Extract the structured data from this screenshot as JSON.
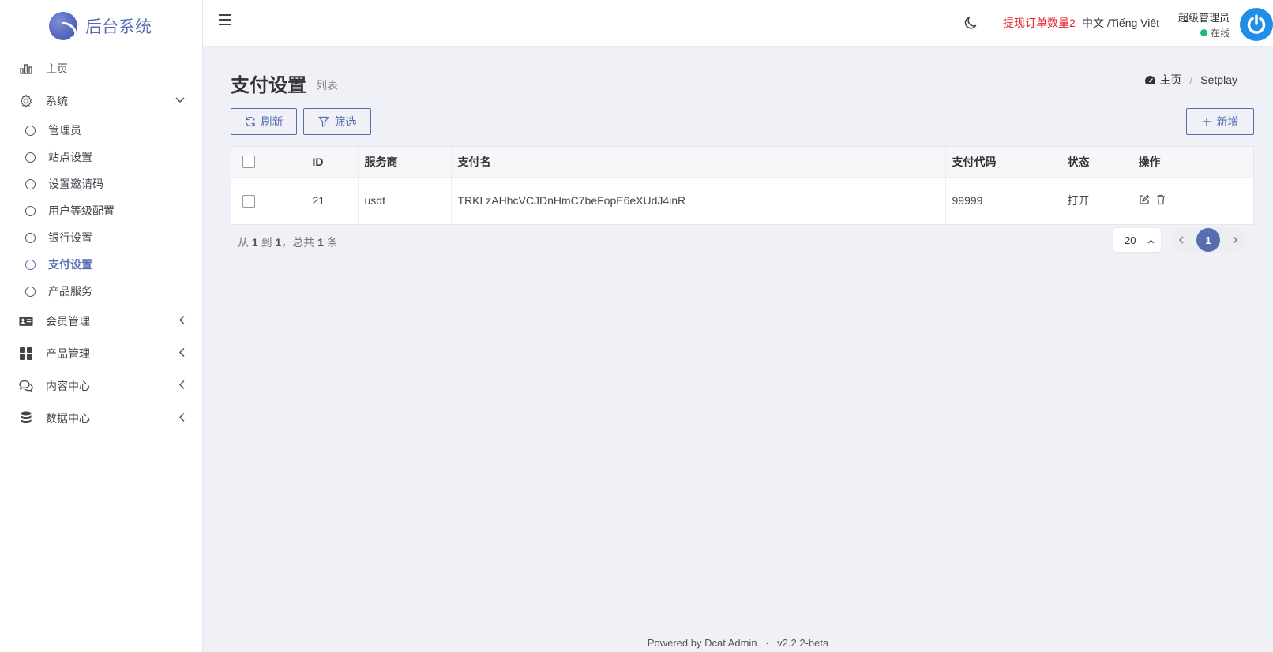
{
  "brand": {
    "name": "后台系统"
  },
  "sidebar": {
    "home": "主页",
    "system": "系统",
    "system_items": [
      "管理员",
      "站点设置",
      "设置邀请码",
      "用户等级配置",
      "银行设置",
      "支付设置",
      "产品服务"
    ],
    "member": "会员管理",
    "product": "产品管理",
    "content": "内容中心",
    "data": "数据中心"
  },
  "header": {
    "withdraw_text": "提现订单数量2",
    "lang_text": "中文 /Tiếng Việt",
    "user_name": "超级管理员",
    "user_status": "在线"
  },
  "page": {
    "title": "支付设置",
    "subtitle": "列表",
    "breadcrumb_home": "主页",
    "breadcrumb_current": "Setplay"
  },
  "toolbar": {
    "refresh_label": "刷新",
    "filter_label": "筛选",
    "new_label": "新增"
  },
  "table": {
    "headers": [
      "ID",
      "服务商",
      "支付名",
      "支付代码",
      "状态",
      "操作"
    ],
    "rows": [
      {
        "id": "21",
        "provider": "usdt",
        "name": "TRKLzAHhcVCJDnHmC7beFopE6eXUdJ4inR",
        "code": "99999",
        "status": "打开"
      }
    ]
  },
  "pagination": {
    "info_from": "从",
    "info_start": "1",
    "info_to": "到",
    "info_end": "1",
    "info_total_pre": "，总共",
    "info_total": "1",
    "info_unit": "条",
    "per_page": "20",
    "current_page": "1"
  },
  "footer": {
    "powered": "Powered by",
    "product": "Dcat Admin",
    "dot": "·",
    "version": "v2.2.2-beta"
  },
  "colors": {
    "accent": "#586cb1",
    "warning_text": "#e3242b",
    "online": "#21b978",
    "avatar": "#1e8ee8"
  }
}
